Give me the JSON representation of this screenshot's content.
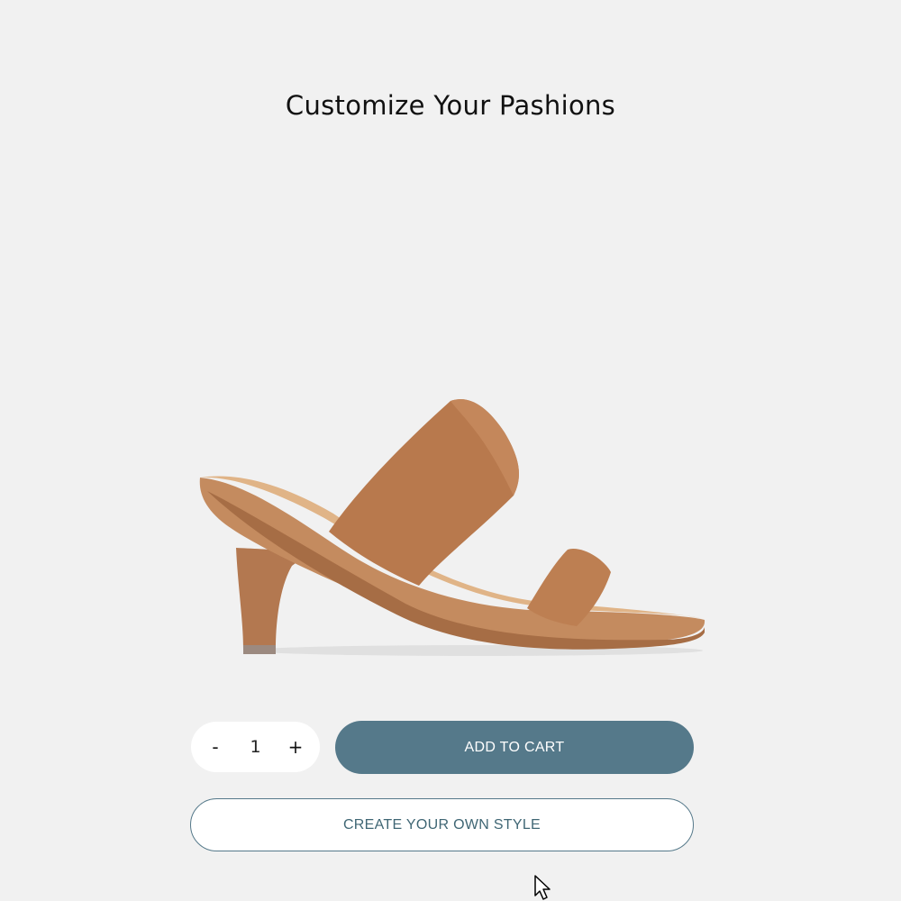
{
  "page": {
    "title": "Customize Your Pashions"
  },
  "product": {
    "image_icon": "tan-heel-sandal-image",
    "color": "#b97a50"
  },
  "quantity": {
    "decrement_label": "-",
    "value": "1",
    "increment_label": "+"
  },
  "actions": {
    "add_to_cart_label": "ADD TO CART",
    "create_style_label": "CREATE YOUR OWN STYLE"
  },
  "colors": {
    "background": "#f1f1f1",
    "accent": "#55798a"
  }
}
